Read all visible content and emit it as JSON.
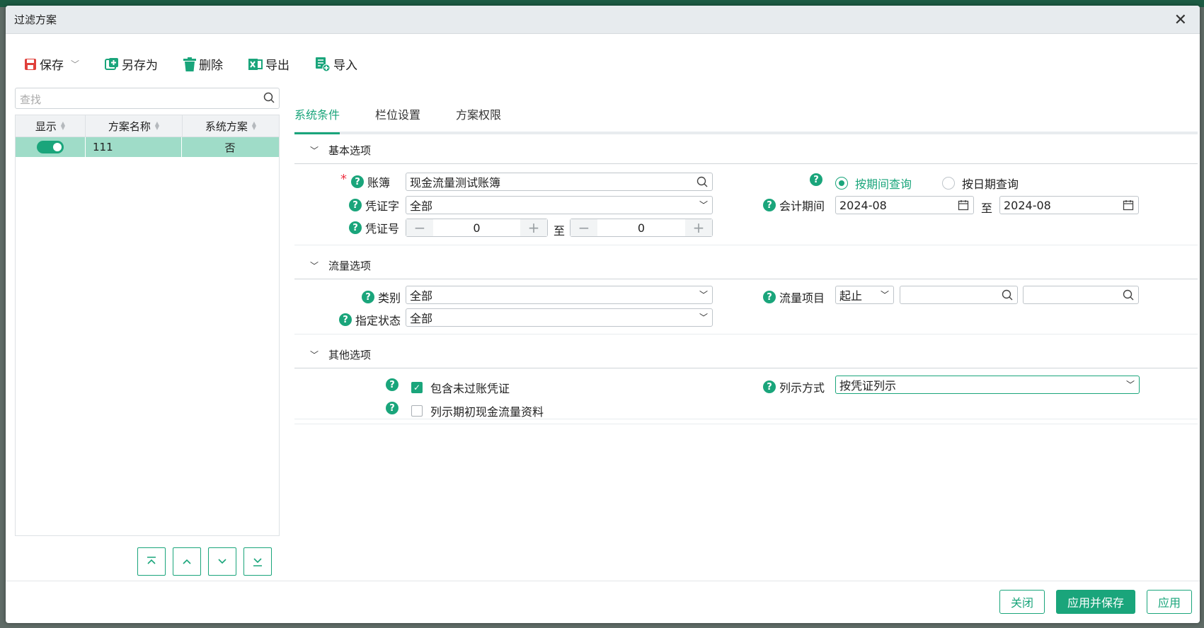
{
  "dialog": {
    "title": "过滤方案"
  },
  "toolbar": {
    "save": "保存",
    "save_as": "另存为",
    "delete": "删除",
    "export": "导出",
    "import": "导入"
  },
  "search": {
    "placeholder": "查找"
  },
  "grid": {
    "headers": [
      "显示",
      "方案名称",
      "系统方案"
    ],
    "rows": [
      {
        "show": true,
        "name": "111",
        "system": "否"
      }
    ]
  },
  "tabs": [
    "系统条件",
    "栏位设置",
    "方案权限"
  ],
  "sections": {
    "basic": "基本选项",
    "flow": "流量选项",
    "other": "其他选项"
  },
  "basic": {
    "ledger_label": "账簿",
    "ledger_value": "现金流量测试账簿",
    "voucher_word_label": "凭证字",
    "voucher_word_value": "全部",
    "voucher_no_label": "凭证号",
    "voucher_no_from": "0",
    "voucher_no_to": "0",
    "to": "至",
    "radio_period": "按期间查询",
    "radio_date": "按日期查询",
    "period_label": "会计期间",
    "period_from": "2024-08",
    "period_to": "2024-08"
  },
  "flow": {
    "category_label": "类别",
    "category_value": "全部",
    "status_label": "指定状态",
    "status_value": "全部",
    "item_label": "流量项目",
    "item_range": "起止"
  },
  "other": {
    "include_unposted": "包含未过账凭证",
    "list_opening": "列示期初现金流量资料",
    "display_label": "列示方式",
    "display_value": "按凭证列示"
  },
  "footer": {
    "close": "关闭",
    "apply_save": "应用并保存",
    "apply": "应用"
  },
  "colors": {
    "accent": "#1aa57b",
    "selected_row": "#9fdcc8"
  }
}
